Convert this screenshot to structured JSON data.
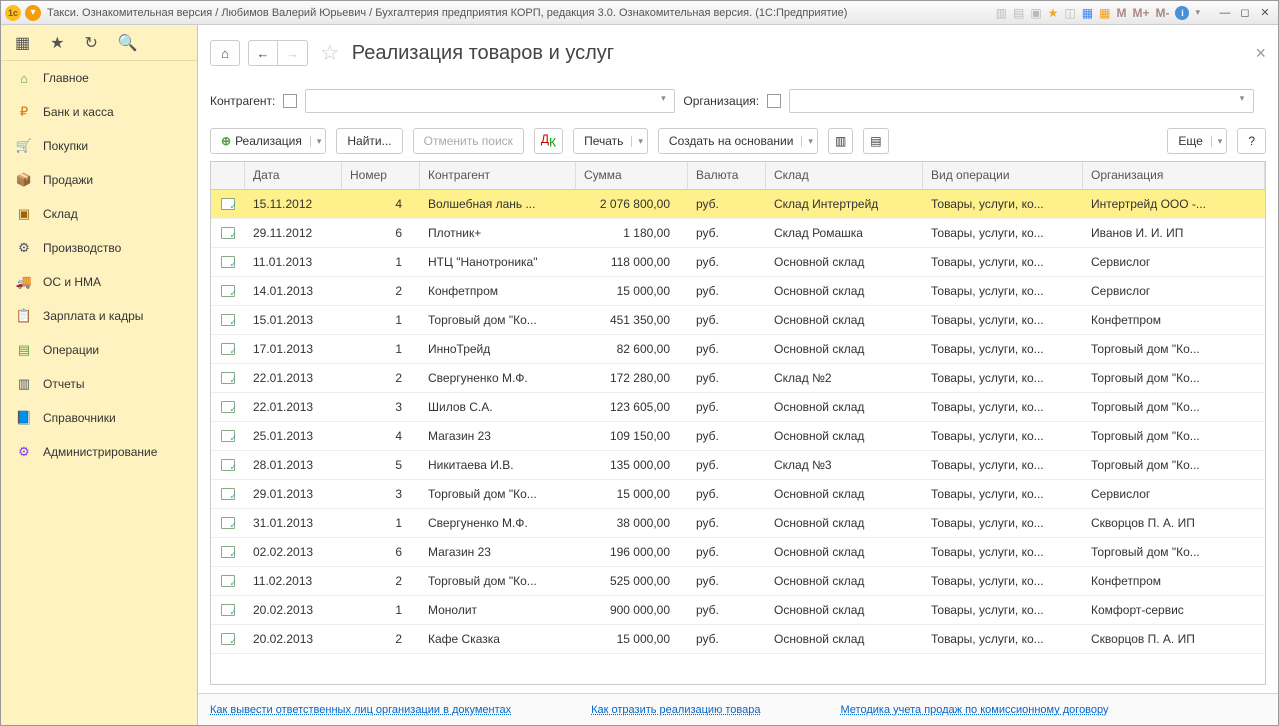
{
  "titlebar": {
    "title": "Такси. Ознакомительная версия / Любимов Валерий Юрьевич / Бухгалтерия предприятия КОРП, редакция 3.0. Ознакомительная версия.  (1С:Предприятие)",
    "m1": "M",
    "m2": "M+",
    "m3": "M-"
  },
  "sidebar": {
    "items": [
      {
        "icon": "⌂",
        "label": "Главное",
        "color": "#5a9e3f"
      },
      {
        "icon": "₽",
        "label": "Банк и касса",
        "color": "#d97706"
      },
      {
        "icon": "🛒",
        "label": "Покупки",
        "color": "#0ea5e9"
      },
      {
        "icon": "📦",
        "label": "Продажи",
        "color": "#d97706"
      },
      {
        "icon": "▣",
        "label": "Склад",
        "color": "#a16207"
      },
      {
        "icon": "⚙",
        "label": "Производство",
        "color": "#4b5563"
      },
      {
        "icon": "🚚",
        "label": "ОС и НМА",
        "color": "#0ea5e9"
      },
      {
        "icon": "📋",
        "label": "Зарплата и кадры",
        "color": "#5a9e3f"
      },
      {
        "icon": "▤",
        "label": "Операции",
        "color": "#5a9e3f"
      },
      {
        "icon": "▥",
        "label": "Отчеты",
        "color": "#4b5563"
      },
      {
        "icon": "📘",
        "label": "Справочники",
        "color": "#d97706"
      },
      {
        "icon": "⚙",
        "label": "Администрирование",
        "color": "#7c3aed"
      }
    ]
  },
  "page": {
    "title": "Реализация товаров и услуг"
  },
  "filters": {
    "counterparty_label": "Контрагент:",
    "organization_label": "Организация:"
  },
  "toolbar": {
    "realization": "Реализация",
    "find": "Найти...",
    "cancel_search": "Отменить поиск",
    "print": "Печать",
    "create_based": "Создать на основании",
    "more": "Еще",
    "help": "?"
  },
  "table": {
    "headers": {
      "date": "Дата",
      "number": "Номер",
      "counterparty": "Контрагент",
      "sum": "Сумма",
      "currency": "Валюта",
      "warehouse": "Склад",
      "operation": "Вид операции",
      "organization": "Организация"
    },
    "rows": [
      {
        "date": "15.11.2012",
        "num": "4",
        "ctr": "Волшебная лань ...",
        "sum": "2 076 800,00",
        "cur": "руб.",
        "stk": "Склад Интертрейд",
        "op": "Товары, услуги, ко...",
        "org": "Интертрейд ООО -...",
        "selected": true
      },
      {
        "date": "29.11.2012",
        "num": "6",
        "ctr": "Плотник+",
        "sum": "1 180,00",
        "cur": "руб.",
        "stk": "Склад Ромашка",
        "op": "Товары, услуги, ко...",
        "org": "Иванов И. И. ИП"
      },
      {
        "date": "11.01.2013",
        "num": "1",
        "ctr": "НТЦ \"Нанотроника\"",
        "sum": "118 000,00",
        "cur": "руб.",
        "stk": "Основной склад",
        "op": "Товары, услуги, ко...",
        "org": "Сервислог"
      },
      {
        "date": "14.01.2013",
        "num": "2",
        "ctr": "Конфетпром",
        "sum": "15 000,00",
        "cur": "руб.",
        "stk": "Основной склад",
        "op": "Товары, услуги, ко...",
        "org": "Сервислог"
      },
      {
        "date": "15.01.2013",
        "num": "1",
        "ctr": "Торговый дом \"Ко...",
        "sum": "451 350,00",
        "cur": "руб.",
        "stk": "Основной склад",
        "op": "Товары, услуги, ко...",
        "org": "Конфетпром"
      },
      {
        "date": "17.01.2013",
        "num": "1",
        "ctr": "ИнноТрейд",
        "sum": "82 600,00",
        "cur": "руб.",
        "stk": "Основной склад",
        "op": "Товары, услуги, ко...",
        "org": "Торговый дом \"Ко..."
      },
      {
        "date": "22.01.2013",
        "num": "2",
        "ctr": "Свергуненко М.Ф.",
        "sum": "172 280,00",
        "cur": "руб.",
        "stk": "Склад №2",
        "op": "Товары, услуги, ко...",
        "org": "Торговый дом \"Ко..."
      },
      {
        "date": "22.01.2013",
        "num": "3",
        "ctr": "Шилов С.А.",
        "sum": "123 605,00",
        "cur": "руб.",
        "stk": "Основной склад",
        "op": "Товары, услуги, ко...",
        "org": "Торговый дом \"Ко..."
      },
      {
        "date": "25.01.2013",
        "num": "4",
        "ctr": "Магазин 23",
        "sum": "109 150,00",
        "cur": "руб.",
        "stk": "Основной склад",
        "op": "Товары, услуги, ко...",
        "org": "Торговый дом \"Ко..."
      },
      {
        "date": "28.01.2013",
        "num": "5",
        "ctr": "Никитаева И.В.",
        "sum": "135 000,00",
        "cur": "руб.",
        "stk": "Склад №3",
        "op": "Товары, услуги, ко...",
        "org": "Торговый дом \"Ко..."
      },
      {
        "date": "29.01.2013",
        "num": "3",
        "ctr": "Торговый дом \"Ко...",
        "sum": "15 000,00",
        "cur": "руб.",
        "stk": "Основной склад",
        "op": "Товары, услуги, ко...",
        "org": "Сервислог"
      },
      {
        "date": "31.01.2013",
        "num": "1",
        "ctr": "Свергуненко М.Ф.",
        "sum": "38 000,00",
        "cur": "руб.",
        "stk": "Основной склад",
        "op": "Товары, услуги, ко...",
        "org": "Скворцов П. А. ИП"
      },
      {
        "date": "02.02.2013",
        "num": "6",
        "ctr": "Магазин 23",
        "sum": "196 000,00",
        "cur": "руб.",
        "stk": "Основной склад",
        "op": "Товары, услуги, ко...",
        "org": "Торговый дом \"Ко..."
      },
      {
        "date": "11.02.2013",
        "num": "2",
        "ctr": "Торговый дом \"Ко...",
        "sum": "525 000,00",
        "cur": "руб.",
        "stk": "Основной склад",
        "op": "Товары, услуги, ко...",
        "org": "Конфетпром"
      },
      {
        "date": "20.02.2013",
        "num": "1",
        "ctr": "Монолит",
        "sum": "900 000,00",
        "cur": "руб.",
        "stk": "Основной склад",
        "op": "Товары, услуги, ко...",
        "org": "Комфорт-сервис"
      },
      {
        "date": "20.02.2013",
        "num": "2",
        "ctr": "Кафе Сказка",
        "sum": "15 000,00",
        "cur": "руб.",
        "stk": "Основной склад",
        "op": "Товары, услуги, ко...",
        "org": "Скворцов П. А. ИП"
      }
    ]
  },
  "footer": {
    "link1": "Как вывести ответственных лиц организации в документах",
    "link2": "Как отразить реализацию товара",
    "link3": "Методика учета продаж по комиссионному договору"
  }
}
